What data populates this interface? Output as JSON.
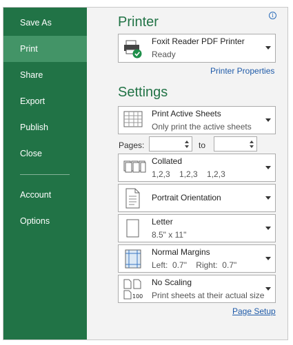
{
  "sidebar": {
    "items": [
      {
        "label": "Save As"
      },
      {
        "label": "Print"
      },
      {
        "label": "Share"
      },
      {
        "label": "Export"
      },
      {
        "label": "Publish"
      },
      {
        "label": "Close"
      },
      {
        "label": "Account"
      },
      {
        "label": "Options"
      }
    ],
    "active": "Print"
  },
  "printer": {
    "title": "Printer",
    "name": "Foxit Reader PDF Printer",
    "status": "Ready",
    "properties_link": "Printer Properties"
  },
  "settings": {
    "title": "Settings",
    "what": {
      "main": "Print Active Sheets",
      "sub": "Only print the active sheets"
    },
    "pages": {
      "label": "Pages:",
      "to": "to",
      "from_value": "",
      "to_value": ""
    },
    "collation": {
      "main": "Collated",
      "sub": "1,2,3    1,2,3    1,2,3"
    },
    "orientation": {
      "main": "Portrait Orientation"
    },
    "paper": {
      "main": "Letter",
      "sub": "8.5\" x 11\""
    },
    "margins": {
      "main": "Normal Margins",
      "sub": "Left:  0.7\"    Right:  0.7\""
    },
    "scaling": {
      "main": "No Scaling",
      "sub": "Print sheets at their actual size",
      "icon_text": "100"
    },
    "page_setup_link": "Page Setup"
  },
  "colors": {
    "accent": "#217346",
    "active_item": "#439467",
    "link": "#1e5aa8"
  },
  "icons": [
    "info-icon",
    "printer-icon",
    "sheets-icon",
    "collated-icon",
    "portrait-icon",
    "paper-icon",
    "margins-icon",
    "scaling-icon"
  ]
}
